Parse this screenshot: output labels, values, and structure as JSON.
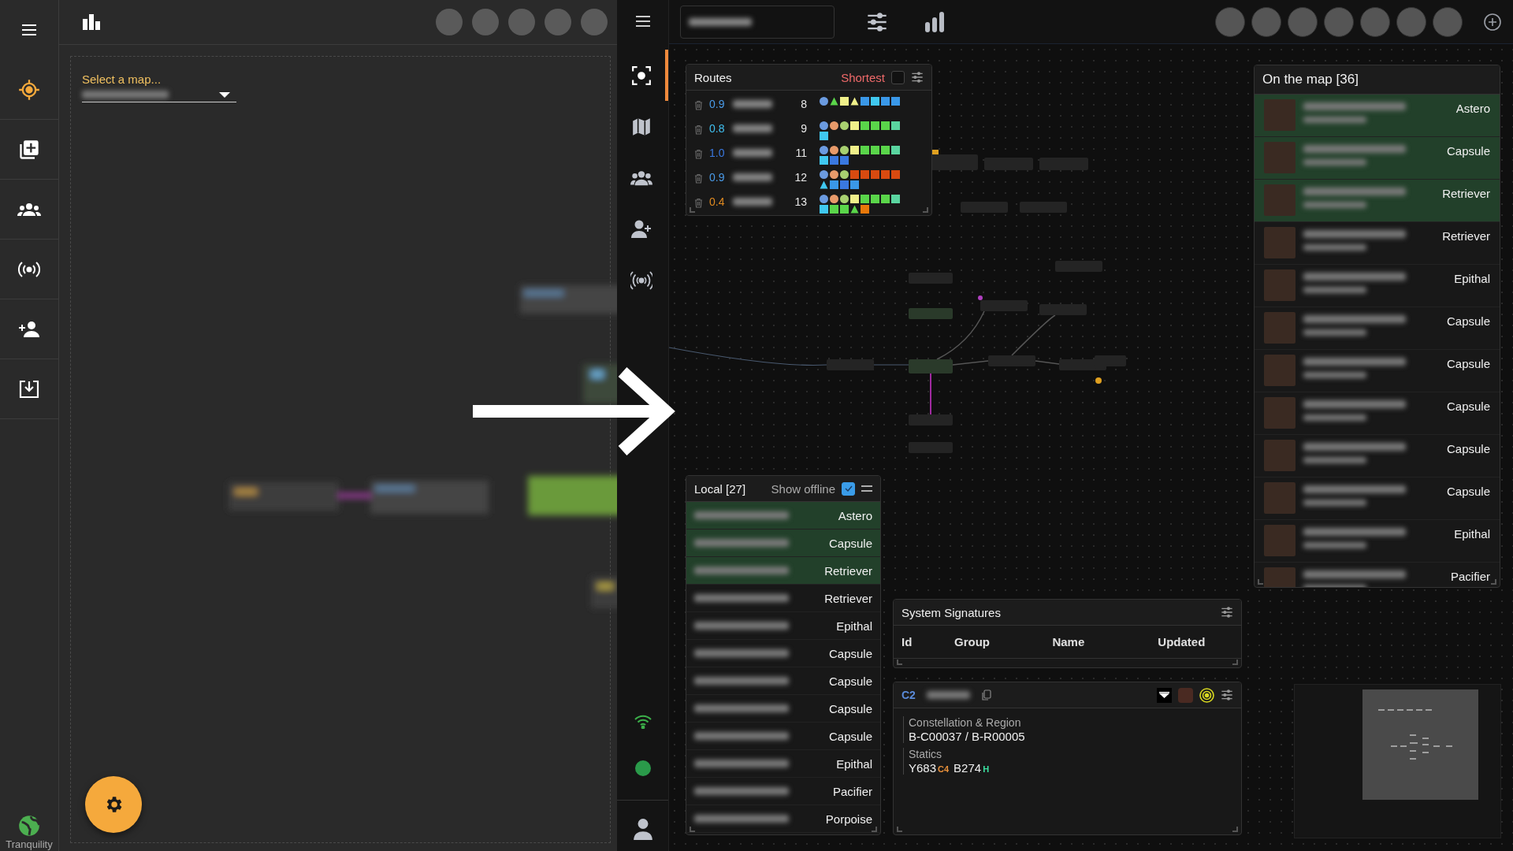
{
  "left_app": {
    "nav": [
      {
        "selected": false
      },
      {
        "selected": true
      },
      {
        "selected": false
      },
      {
        "selected": false
      },
      {
        "selected": false
      },
      {
        "selected": false
      },
      {
        "selected": false
      }
    ],
    "map_select": {
      "label": "Select a map..."
    },
    "server_status": "Tranquility"
  },
  "right_app": {
    "nav": [
      {
        "selected": true
      },
      {
        "selected": false
      },
      {
        "selected": false
      },
      {
        "selected": false
      },
      {
        "selected": false
      }
    ],
    "routes": {
      "title": "Routes",
      "shortest_label": "Shortest",
      "shortest_checked": false,
      "rows": [
        {
          "security": "0.9",
          "jumps": "8",
          "systems": [
            {
              "kind": "circle",
              "color": "#6b9be0"
            },
            {
              "kind": "triangle",
              "color": "#5ad54a"
            },
            {
              "kind": "square",
              "color": "#f0f08a"
            },
            {
              "kind": "triangle",
              "color": "#f0f08a"
            },
            {
              "kind": "square",
              "color": "#3a98e8"
            },
            {
              "kind": "square",
              "color": "#40c8f0"
            },
            {
              "kind": "square",
              "color": "#3a98e8"
            },
            {
              "kind": "square",
              "color": "#3a98e8"
            }
          ]
        },
        {
          "security": "0.8",
          "jumps": "9",
          "systems": [
            {
              "kind": "circle",
              "color": "#6b9be0"
            },
            {
              "kind": "circle",
              "color": "#e89a6a"
            },
            {
              "kind": "circle",
              "color": "#a8d070"
            },
            {
              "kind": "square",
              "color": "#f0f08a"
            },
            {
              "kind": "square",
              "color": "#5ad54a"
            },
            {
              "kind": "square",
              "color": "#5ad54a"
            },
            {
              "kind": "square",
              "color": "#5ad54a"
            },
            {
              "kind": "square",
              "color": "#5ad5a0"
            },
            {
              "kind": "square",
              "color": "#40c8f0"
            }
          ]
        },
        {
          "security": "1.0",
          "jumps": "11",
          "systems": [
            {
              "kind": "circle",
              "color": "#6b9be0"
            },
            {
              "kind": "circle",
              "color": "#e89a6a"
            },
            {
              "kind": "circle",
              "color": "#a8d070"
            },
            {
              "kind": "square",
              "color": "#f0f08a"
            },
            {
              "kind": "square",
              "color": "#5ad54a"
            },
            {
              "kind": "square",
              "color": "#5ad54a"
            },
            {
              "kind": "square",
              "color": "#5ad54a"
            },
            {
              "kind": "square",
              "color": "#5ad5a0"
            },
            {
              "kind": "square",
              "color": "#40c8f0"
            },
            {
              "kind": "square",
              "color": "#3a78e0"
            },
            {
              "kind": "square",
              "color": "#3a78e0"
            }
          ]
        },
        {
          "security": "0.9",
          "jumps": "12",
          "systems": [
            {
              "kind": "circle",
              "color": "#6b9be0"
            },
            {
              "kind": "circle",
              "color": "#e89a6a"
            },
            {
              "kind": "circle",
              "color": "#a8d070"
            },
            {
              "kind": "square",
              "color": "#d84a10"
            },
            {
              "kind": "square",
              "color": "#d84a10"
            },
            {
              "kind": "square",
              "color": "#d84a10"
            },
            {
              "kind": "square",
              "color": "#d84a10"
            },
            {
              "kind": "square",
              "color": "#d84a10"
            },
            {
              "kind": "triangle",
              "color": "#40c8f0"
            },
            {
              "kind": "square",
              "color": "#3a98e8"
            },
            {
              "kind": "square",
              "color": "#3a78e0"
            },
            {
              "kind": "square",
              "color": "#3a98e8"
            }
          ]
        },
        {
          "security": "0.4",
          "jumps": "13",
          "systems": [
            {
              "kind": "circle",
              "color": "#6b9be0"
            },
            {
              "kind": "circle",
              "color": "#e89a6a"
            },
            {
              "kind": "circle",
              "color": "#a8d070"
            },
            {
              "kind": "square",
              "color": "#f0f08a"
            },
            {
              "kind": "square",
              "color": "#5ad54a"
            },
            {
              "kind": "square",
              "color": "#5ad54a"
            },
            {
              "kind": "square",
              "color": "#5ad54a"
            },
            {
              "kind": "square",
              "color": "#5ad5a0"
            },
            {
              "kind": "square",
              "color": "#40c8f0"
            },
            {
              "kind": "square",
              "color": "#5ad54a"
            },
            {
              "kind": "square",
              "color": "#5ad54a"
            },
            {
              "kind": "triangle",
              "color": "#5ad54a"
            },
            {
              "kind": "square",
              "color": "#e8780a"
            }
          ]
        }
      ]
    },
    "local": {
      "title": "Local [27]",
      "show_offline_label": "Show offline",
      "show_offline_checked": true,
      "rows": [
        {
          "ship": "Astero",
          "highlighted": true
        },
        {
          "ship": "Capsule",
          "highlighted": true
        },
        {
          "ship": "Retriever",
          "highlighted": true
        },
        {
          "ship": "Retriever",
          "highlighted": false
        },
        {
          "ship": "Epithal",
          "highlighted": false
        },
        {
          "ship": "Capsule",
          "highlighted": false
        },
        {
          "ship": "Capsule",
          "highlighted": false
        },
        {
          "ship": "Capsule",
          "highlighted": false
        },
        {
          "ship": "Capsule",
          "highlighted": false
        },
        {
          "ship": "Epithal",
          "highlighted": false
        },
        {
          "ship": "Pacifier",
          "highlighted": false
        },
        {
          "ship": "Porpoise",
          "highlighted": false
        }
      ]
    },
    "on_the_map": {
      "title": "On the map [36]",
      "rows": [
        {
          "ship": "Astero",
          "highlighted": true
        },
        {
          "ship": "Capsule",
          "highlighted": true
        },
        {
          "ship": "Retriever",
          "highlighted": true
        },
        {
          "ship": "Retriever",
          "highlighted": false
        },
        {
          "ship": "Epithal",
          "highlighted": false
        },
        {
          "ship": "Capsule",
          "highlighted": false
        },
        {
          "ship": "Capsule",
          "highlighted": false
        },
        {
          "ship": "Capsule",
          "highlighted": false
        },
        {
          "ship": "Capsule",
          "highlighted": false
        },
        {
          "ship": "Capsule",
          "highlighted": false
        },
        {
          "ship": "Epithal",
          "highlighted": false
        },
        {
          "ship": "Pacifier",
          "highlighted": false
        }
      ]
    },
    "signatures": {
      "title": "System Signatures",
      "columns": [
        "Id",
        "Group",
        "Name",
        "Updated"
      ]
    },
    "system_info": {
      "class": "C2",
      "constellation_label": "Constellation & Region",
      "constellation_value": "B-C00037 / B-R00005",
      "statics_label": "Statics",
      "statics": [
        {
          "name": "Y683",
          "class": "C4",
          "color": "#e8903a"
        },
        {
          "name": "B274",
          "class": "H",
          "color": "#3ae0a0"
        }
      ]
    }
  }
}
